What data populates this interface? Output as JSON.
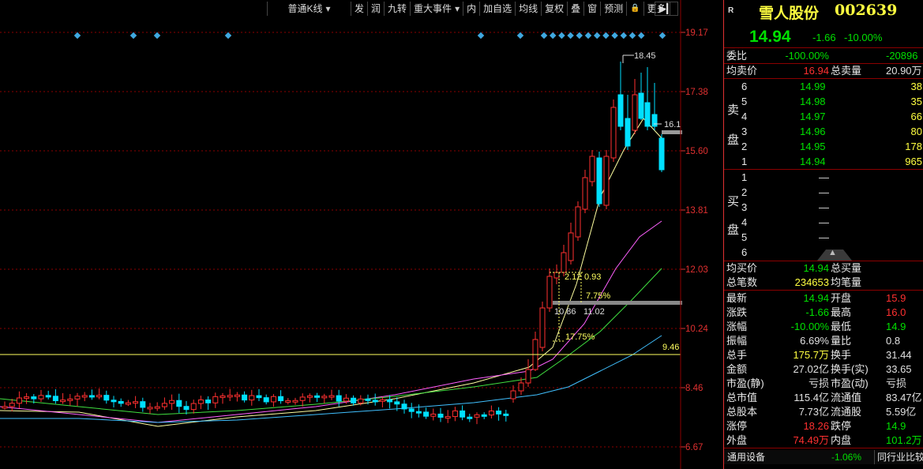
{
  "toolbar": {
    "kline_type": "普通K线",
    "items": [
      "发",
      "润",
      "九转",
      "重大事件",
      "内",
      "加自选",
      "均线",
      "复权",
      "叠",
      "窗",
      "预测",
      "更多"
    ]
  },
  "chart_data": {
    "type": "candlestick",
    "price_ticks": [
      "19.17",
      "17.38",
      "15.60",
      "13.81",
      "12.03",
      "10.24",
      "8.46",
      "6.67"
    ],
    "annotations": {
      "high": "18.45",
      "right_level": "16.1",
      "ref_level": "9.46",
      "measure_a": "2.12",
      "measure_b": "0.93",
      "pct_a": "7.75%",
      "pct_b": "17.75%",
      "range_low": "10.86",
      "range_high": "11.02"
    }
  },
  "quote": {
    "stock_name": "雪人股份",
    "code": "002639",
    "price": "14.94",
    "change": "-1.66",
    "change_pct": "-10.00%",
    "weibi_label": "委比",
    "weibi": "-100.00%",
    "weicha": "-20896",
    "avg_sell_label": "均卖价",
    "avg_sell": "16.94",
    "total_sell_label": "总卖量",
    "total_sell": "20.90万",
    "sell_side_label": [
      "卖",
      "盘"
    ],
    "sell": [
      {
        "n": "6",
        "p": "14.99",
        "v": "38"
      },
      {
        "n": "5",
        "p": "14.98",
        "v": "35"
      },
      {
        "n": "4",
        "p": "14.97",
        "v": "66"
      },
      {
        "n": "3",
        "p": "14.96",
        "v": "80"
      },
      {
        "n": "2",
        "p": "14.95",
        "v": "178"
      },
      {
        "n": "1",
        "p": "14.94",
        "v": "965"
      }
    ],
    "buy_side_label": [
      "买",
      "盘"
    ],
    "buy": [
      {
        "n": "1",
        "p": "—"
      },
      {
        "n": "2",
        "p": "—"
      },
      {
        "n": "3",
        "p": "—"
      },
      {
        "n": "4",
        "p": "—"
      },
      {
        "n": "5",
        "p": "—"
      },
      {
        "n": "6",
        "p": ""
      }
    ],
    "avg_buy_label": "均买价",
    "avg_buy": "14.94",
    "total_buy_label": "总买量",
    "total_trades_label": "总笔数",
    "total_trades": "234653",
    "avg_trade_label": "均笔量",
    "stats": [
      {
        "l1": "最新",
        "v1": "14.94",
        "c1": "grn",
        "l2": "开盘",
        "v2": "15.9",
        "c2": "red"
      },
      {
        "l1": "涨跌",
        "v1": "-1.66",
        "c1": "grn",
        "l2": "最高",
        "v2": "16.0",
        "c2": "red"
      },
      {
        "l1": "涨幅",
        "v1": "-10.00%",
        "c1": "grn",
        "l2": "最低",
        "v2": "14.9",
        "c2": "grn"
      },
      {
        "l1": "振幅",
        "v1": "6.69%",
        "c1": "wht",
        "l2": "量比",
        "v2": "0.8",
        "c2": "wht"
      },
      {
        "l1": "总手",
        "v1": "175.7万",
        "c1": "yel",
        "l2": "换手",
        "v2": "31.44",
        "c2": "wht"
      },
      {
        "l1": "金额",
        "v1": "27.02亿",
        "c1": "wht",
        "l2": "换手(实)",
        "v2": "33.65",
        "c2": "wht"
      },
      {
        "l1": "市盈(静)",
        "v1": "亏损",
        "c1": "wht",
        "l2": "市盈(动)",
        "v2": "亏损",
        "c2": "wht"
      },
      {
        "l1": "总市值",
        "v1": "115.4亿",
        "c1": "wht",
        "l2": "流通值",
        "v2": "83.47亿",
        "c2": "wht"
      },
      {
        "l1": "总股本",
        "v1": "7.73亿",
        "c1": "wht",
        "l2": "流通股",
        "v2": "5.59亿",
        "c2": "wht"
      },
      {
        "l1": "涨停",
        "v1": "18.26",
        "c1": "red",
        "l2": "跌停",
        "v2": "14.9",
        "c2": "grn"
      },
      {
        "l1": "外盘",
        "v1": "74.49万",
        "c1": "red",
        "l2": "内盘",
        "v2": "101.2万",
        "c2": "grn"
      }
    ],
    "sector_name": "通用设备",
    "sector_change": "-1.06%",
    "peer_compare": "同行业比较"
  },
  "colors": {
    "up": "#ff3030",
    "down": "#00e0ff",
    "grid": "#8b0000"
  }
}
